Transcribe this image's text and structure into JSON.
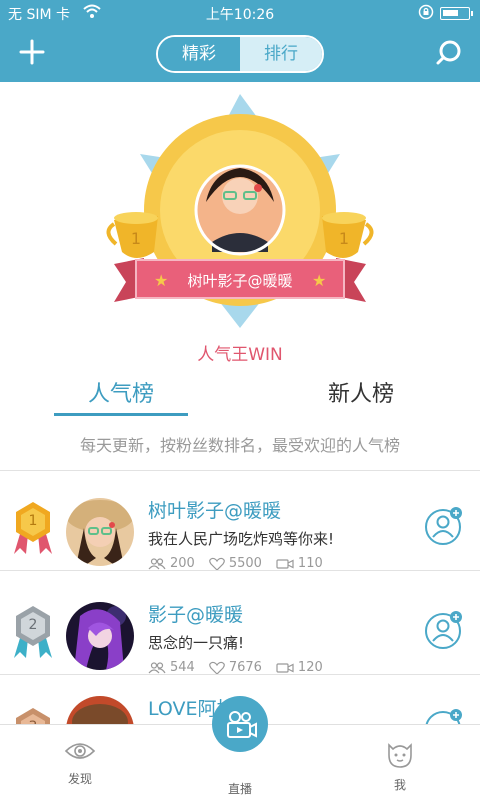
{
  "status_bar": {
    "carrier": "无 SIM 卡",
    "time": "上午10:26",
    "battery_level": 0.65
  },
  "header": {
    "tabs": [
      {
        "label": "精彩",
        "active": true
      },
      {
        "label": "排行",
        "active": false
      }
    ],
    "add_icon": "plus-icon",
    "search_icon": "search-icon"
  },
  "hero": {
    "banner_name": "树叶影子@暖暖",
    "caption": "人气王WIN"
  },
  "ranking": {
    "tabs": [
      {
        "label": "人气榜",
        "active": true
      },
      {
        "label": "新人榜",
        "active": false
      }
    ],
    "description": "每天更新，按粉丝数排名，最受欢迎的人气榜"
  },
  "list": [
    {
      "rank": "1",
      "name": "树叶影子@暖暖",
      "message": "我在人民广场吃炸鸡等你来!",
      "followers": "200",
      "likes": "5500",
      "videos": "110"
    },
    {
      "rank": "2",
      "name": "影子@暖暖",
      "message": "思念的一只痛!",
      "followers": "544",
      "likes": "7676",
      "videos": "120"
    },
    {
      "rank": "3",
      "name": "LOVE阿拉蕾",
      "message": "",
      "followers": "",
      "likes": "",
      "videos": ""
    }
  ],
  "bottom_nav": {
    "discover": "发现",
    "live": "直播",
    "me": "我"
  },
  "colors": {
    "primary": "#4aa8c8",
    "banner_red": "#e0566e",
    "gold": "#f6c84a"
  }
}
